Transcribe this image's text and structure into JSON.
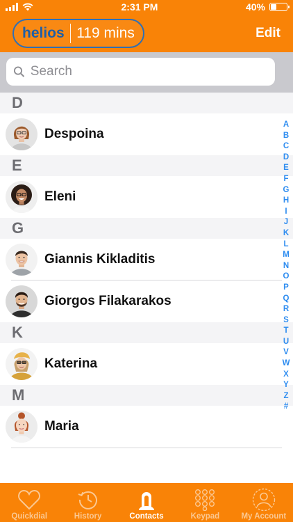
{
  "status_bar": {
    "time": "2:31 PM",
    "battery": "40%",
    "battery_level": 0.4
  },
  "header": {
    "brand": "helios",
    "minutes": "119 mins",
    "edit_label": "Edit"
  },
  "search": {
    "placeholder": "Search",
    "value": ""
  },
  "colors": {
    "accent": "#f98307",
    "brand_blue": "#1f5fa8",
    "index_blue": "#2d8cf0"
  },
  "sections": [
    {
      "letter": "D",
      "contacts": [
        {
          "name": "Despoina"
        }
      ]
    },
    {
      "letter": "E",
      "contacts": [
        {
          "name": "Eleni"
        }
      ]
    },
    {
      "letter": "G",
      "contacts": [
        {
          "name": "Giannis Kikladitis"
        },
        {
          "name": "Giorgos Filakarakos"
        }
      ]
    },
    {
      "letter": "K",
      "contacts": [
        {
          "name": "Katerina"
        }
      ]
    },
    {
      "letter": "M",
      "contacts": [
        {
          "name": "Maria"
        }
      ]
    }
  ],
  "index_letters": [
    "A",
    "B",
    "C",
    "D",
    "E",
    "F",
    "G",
    "H",
    "I",
    "J",
    "K",
    "L",
    "M",
    "N",
    "O",
    "P",
    "Q",
    "R",
    "S",
    "T",
    "U",
    "V",
    "W",
    "X",
    "Y",
    "Z",
    "#"
  ],
  "tabs": [
    {
      "label": "Quickdial",
      "icon": "heart-icon",
      "active": false
    },
    {
      "label": "History",
      "icon": "history-icon",
      "active": false
    },
    {
      "label": "Contacts",
      "icon": "contacts-icon",
      "active": true
    },
    {
      "label": "Keypad",
      "icon": "keypad-icon",
      "active": false
    },
    {
      "label": "My Account",
      "icon": "account-icon",
      "active": false
    }
  ]
}
